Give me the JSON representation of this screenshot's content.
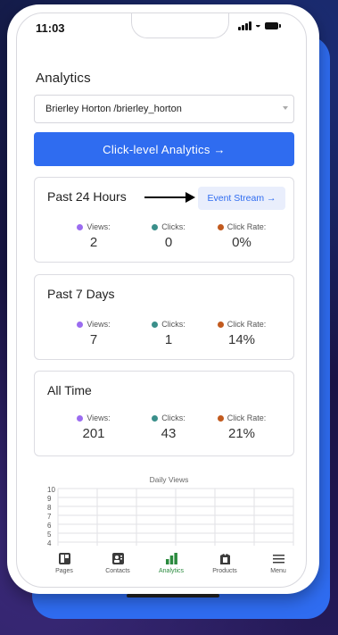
{
  "status_bar": {
    "time": "11:03"
  },
  "page_title": "Analytics",
  "account_select": {
    "value": "Brierley Horton  /brierley_horton"
  },
  "cta_label": "Click-level Analytics →",
  "event_stream_label": "Event Stream →",
  "colors": {
    "accent": "#2f6cf0",
    "views": "#9b6cf0",
    "clicks": "#3a8f8a",
    "click_rate": "#c25a1e",
    "tab_active": "#2a8a3e"
  },
  "stat_labels": {
    "views": "Views:",
    "clicks": "Clicks:",
    "click_rate": "Click Rate:"
  },
  "periods": [
    {
      "title": "Past 24 Hours",
      "views": "2",
      "clicks": "0",
      "click_rate": "0%"
    },
    {
      "title": "Past 7 Days",
      "views": "7",
      "clicks": "1",
      "click_rate": "14%"
    },
    {
      "title": "All Time",
      "views": "201",
      "clicks": "43",
      "click_rate": "21%"
    }
  ],
  "chart": {
    "title": "Daily Views",
    "y_ticks": [
      "10",
      "9",
      "8",
      "7",
      "6",
      "5",
      "4"
    ]
  },
  "tabs": [
    {
      "label": "Pages",
      "icon": "pages-icon",
      "active": false
    },
    {
      "label": "Contacts",
      "icon": "contacts-icon",
      "active": false
    },
    {
      "label": "Analytics",
      "icon": "analytics-icon",
      "active": true
    },
    {
      "label": "Products",
      "icon": "products-icon",
      "active": false
    },
    {
      "label": "Menu",
      "icon": "menu-icon",
      "active": false
    }
  ]
}
